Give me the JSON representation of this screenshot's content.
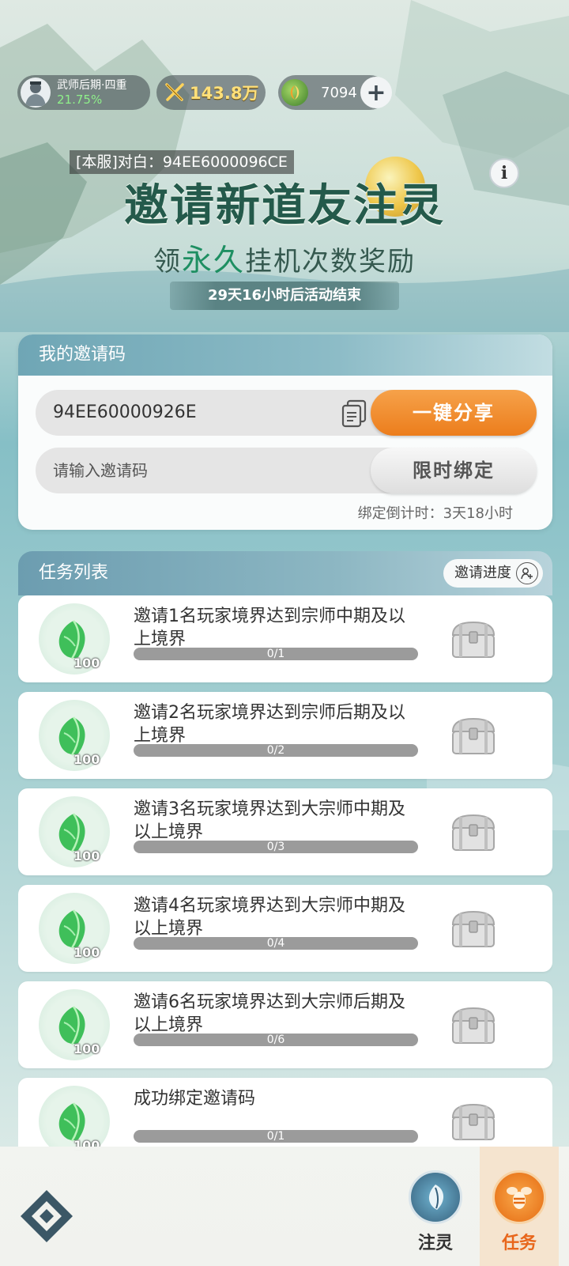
{
  "status": {
    "rank_name": "武师后期·四重",
    "rank_percent": "21.75%",
    "power": "143.8万",
    "coins": "7094",
    "add_label": "+"
  },
  "banner": {
    "chat": "[本服]对白：94EE6000096CE",
    "title": "邀请新道友注灵",
    "subtitle_pre": "领",
    "subtitle_hl": "永久",
    "subtitle_post": "挂机次数奖励",
    "countdown": "29天16小时后活动结束",
    "info_label": "i"
  },
  "invite": {
    "header": "我的邀请码",
    "code": "94EE60000926E",
    "share_label": "一键分享",
    "input_placeholder": "请输入邀请码",
    "bind_label": "限时绑定",
    "bind_countdown": "绑定倒计时：3天18小时"
  },
  "tasks": {
    "header": "任务列表",
    "progress_label": "邀请进度",
    "items": [
      {
        "desc": "邀请1名玩家境界达到宗师中期及以上境界",
        "reward_qty": "100",
        "progress_text": "0/1",
        "progress": 0
      },
      {
        "desc": "邀请2名玩家境界达到宗师后期及以上境界",
        "reward_qty": "100",
        "progress_text": "0/2",
        "progress": 0
      },
      {
        "desc": "邀请3名玩家境界达到大宗师中期及以上境界",
        "reward_qty": "100",
        "progress_text": "0/3",
        "progress": 0
      },
      {
        "desc": "邀请4名玩家境界达到大宗师中期及以上境界",
        "reward_qty": "100",
        "progress_text": "0/4",
        "progress": 0
      },
      {
        "desc": "邀请6名玩家境界达到大宗师后期及以上境界",
        "reward_qty": "100",
        "progress_text": "0/6",
        "progress": 0
      },
      {
        "desc": "成功绑定邀请码",
        "reward_qty": "100",
        "progress_text": "0/1",
        "progress": 0
      }
    ]
  },
  "nav": {
    "tab_inject": "注灵",
    "tab_task": "任务",
    "active": "任务"
  },
  "colors": {
    "accent_orange": "#ec7d1c",
    "title_green": "#245a4b",
    "progress_green": "#8ff08a",
    "power_gold": "#ffe07a"
  },
  "icons": {
    "avatar": "swordsman-avatar",
    "power": "crossed-swords-icon",
    "coin": "spirit-coin-icon",
    "copy": "copy-icon",
    "reward": "jade-leaf-icon",
    "chest": "treasure-chest-icon",
    "back": "diamond-back-icon",
    "inject": "leaf-emblem-icon",
    "task": "bee-emblem-icon"
  }
}
